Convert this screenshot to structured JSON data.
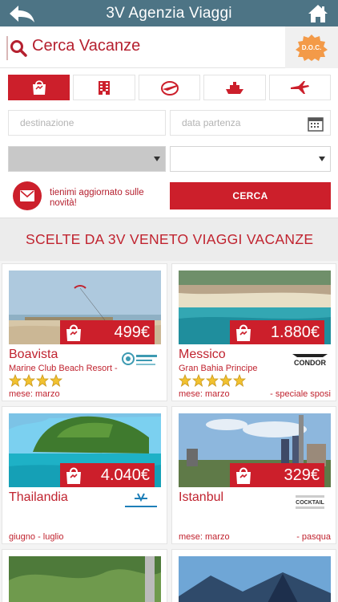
{
  "header": {
    "title": "3V Agenzia Viaggi",
    "back_icon": "back-arrow-icon",
    "home_icon": "home-icon"
  },
  "search": {
    "title": "Cerca Vacanze",
    "destination_placeholder": "destinazione",
    "date_placeholder": "data partenza",
    "doc_badge": "D.O.C.",
    "cerca_label": "CERCA",
    "newsletter_label": "tienimi aggiornato sulle novità!"
  },
  "categories": [
    {
      "name": "holiday",
      "icon": "travel-bag-icon",
      "active": true
    },
    {
      "name": "hotel",
      "icon": "hotel-building-icon",
      "active": false
    },
    {
      "name": "flight-world",
      "icon": "globe-plane-icon",
      "active": false
    },
    {
      "name": "cruise",
      "icon": "ship-icon",
      "active": false
    },
    {
      "name": "flight",
      "icon": "airplane-icon",
      "active": false
    }
  ],
  "section_title": "SCELTE DA 3V VENETO VIAGGI VACANZE",
  "offers": [
    {
      "destination": "Boavista",
      "hotel": "Marine Club Beach Resort -",
      "stars": 4,
      "month": "mese: marzo",
      "note": "",
      "price": "499€",
      "brand": "Viaggi Alpitour"
    },
    {
      "destination": "Messico",
      "hotel": "Gran Bahia Principe",
      "stars": 5,
      "month": "mese: marzo",
      "note": "- speciale sposi",
      "price": "1.880€",
      "brand": "CONDOR"
    },
    {
      "destination": "Thailandia",
      "hotel": "",
      "stars": 0,
      "month": "giugno - luglio",
      "note": "",
      "price": "4.040€",
      "brand": "Eden Viaggi"
    },
    {
      "destination": "Istanbul",
      "hotel": "",
      "stars": 0,
      "month": "mese: marzo",
      "note": "- pasqua",
      "price": "329€",
      "brand": "COCKTAIL"
    }
  ],
  "colors": {
    "accent": "#cc1f2b",
    "header": "#4d7485",
    "text_red": "#c0232f"
  }
}
